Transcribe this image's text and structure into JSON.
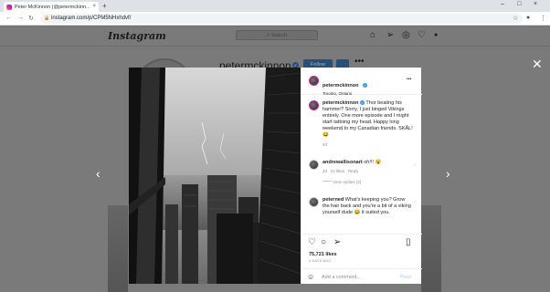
{
  "browser": {
    "tab_title": "Peter McKinnon (@petermckinn...",
    "tab_close": "×",
    "new_tab": "+",
    "url": "instagram.com/p/CPM5NHxhdvf/",
    "window_controls": [
      "–",
      "□",
      "×"
    ]
  },
  "instagram": {
    "logo": "Instagram",
    "search_placeholder": "Search",
    "background": {
      "username": "petermckinnon",
      "follow_label": "Follow",
      "more": "•••"
    }
  },
  "modal": {
    "close": "✕",
    "prev_arrow": "‹",
    "next_arrow": "›",
    "header": {
      "username": "petermckinnon",
      "location": "Toronto, Ontario",
      "more": "•••"
    },
    "caption": {
      "username": "petermckinnon",
      "text": "Thor beating his hammer? Sorry, I just binged Vikings entirely. One more episode and I might start tattoing my head. Happy long weekend to my Canadian friends. SKÅL! 😂",
      "time": "4d"
    },
    "comments": [
      {
        "username": "andrewallisonart",
        "text": "oh!!! 😮",
        "time": "4d",
        "likes": "24 likes",
        "reply": "Reply",
        "view_replies": "View replies (2)"
      },
      {
        "username": "peterned",
        "text": "What's keeping you? Grow the hair back and you're a bit of a viking yourself dude 😂 it suited you."
      }
    ],
    "likes": "75,721 likes",
    "time_ago": "4 DAYS AGO",
    "add_comment_placeholder": "Add a comment...",
    "post_label": "Post"
  }
}
